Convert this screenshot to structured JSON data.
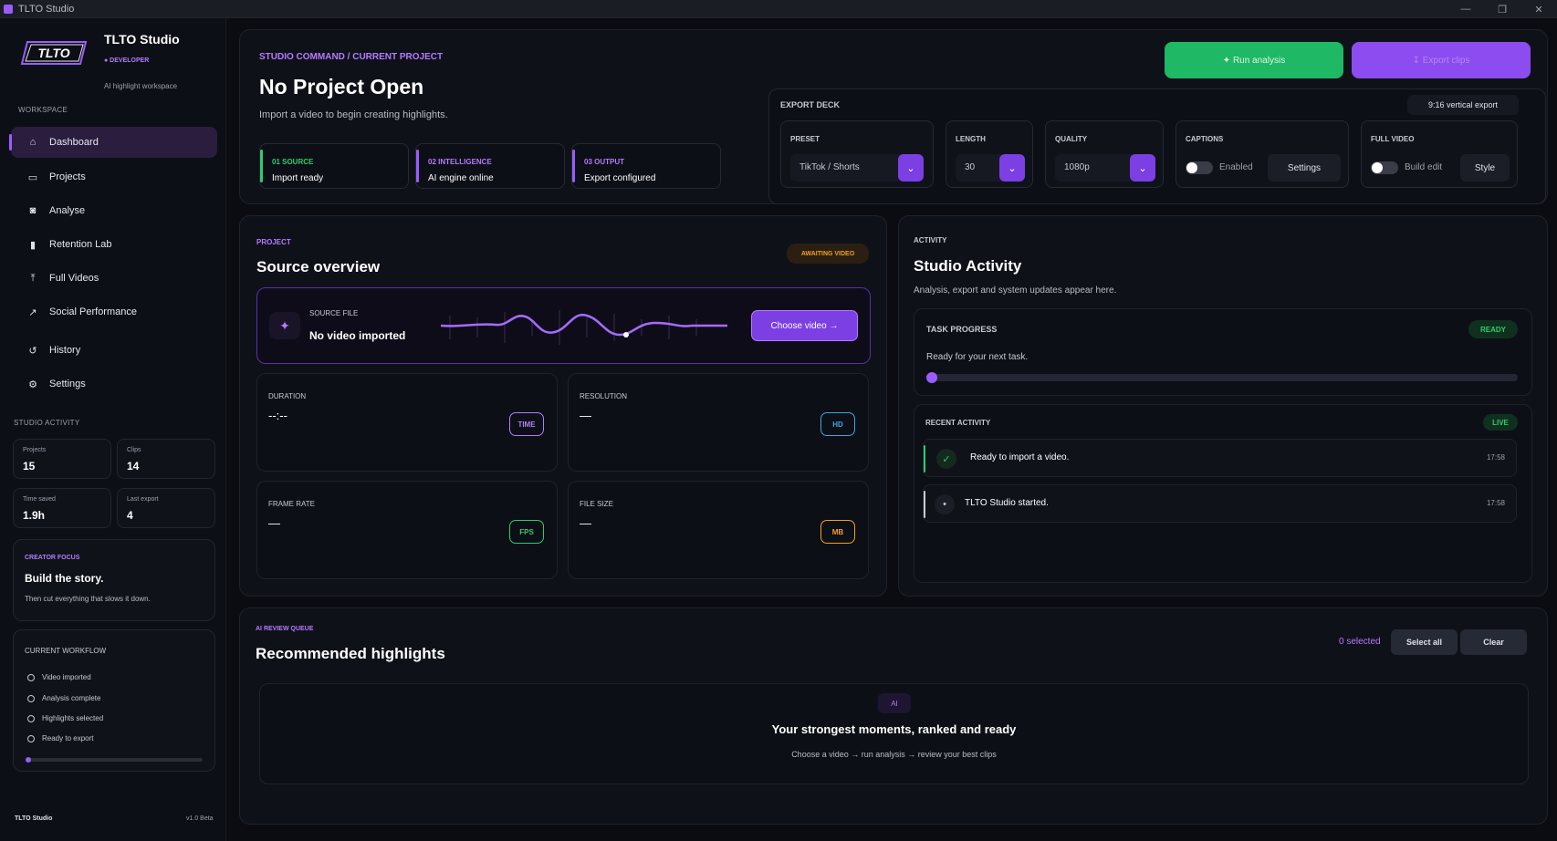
{
  "window": {
    "title": "TLTO Studio",
    "minimize": "—",
    "restore": "❐",
    "close": "✕"
  },
  "brand": {
    "logo_text": "TLTO",
    "name": "TLTO Studio",
    "badge": "● DEVELOPER",
    "tagline": "AI highlight workspace"
  },
  "sidebar": {
    "workspace_label": "WORKSPACE",
    "items": [
      {
        "icon": "⌂",
        "label": "Dashboard",
        "active": true
      },
      {
        "icon": "▭",
        "label": "Projects"
      },
      {
        "icon": "◙",
        "label": "Analyse"
      },
      {
        "icon": "▮",
        "label": "Retention Lab"
      },
      {
        "icon": "⤒",
        "label": "Full Videos"
      },
      {
        "icon": "↗",
        "label": "Social Performance"
      },
      {
        "icon": "↺",
        "label": "History"
      },
      {
        "icon": "⚙",
        "label": "Settings"
      }
    ],
    "activity_label": "STUDIO ACTIVITY",
    "stats": [
      {
        "label": "Projects",
        "value": "15"
      },
      {
        "label": "Clips",
        "value": "14"
      },
      {
        "label": "Time saved",
        "value": "1.9h"
      },
      {
        "label": "Last export",
        "value": "4"
      }
    ],
    "focus": {
      "label": "CREATOR FOCUS",
      "title": "Build the story.",
      "text": "Then cut everything that slows it down."
    },
    "workflow": {
      "label": "CURRENT WORKFLOW",
      "steps": [
        "Video imported",
        "Analysis complete",
        "Highlights selected",
        "Ready to export"
      ],
      "progress": 0.02
    },
    "footer_name": "TLTO Studio",
    "footer_version": "v1.0 Beta"
  },
  "header": {
    "breadcrumb": "STUDIO COMMAND  /  CURRENT PROJECT",
    "title": "No Project Open",
    "subtitle": "Import a video to begin creating highlights.",
    "steps": [
      {
        "num": "01  SOURCE",
        "text": "Import ready",
        "color": "#2ecc71"
      },
      {
        "num": "02  INTELLIGENCE",
        "text": "AI engine online",
        "color": "#9b5cff"
      },
      {
        "num": "03  OUTPUT",
        "text": "Export configured",
        "color": "#9b5cff"
      }
    ],
    "run_label": "✦  Run analysis",
    "export_label": "↧  Export clips"
  },
  "deck": {
    "label": "EXPORT DECK",
    "pill": "9:16 vertical export",
    "preset_label": "PRESET",
    "preset_value": "TikTok / Shorts",
    "length_label": "LENGTH",
    "length_value": "30",
    "quality_label": "QUALITY",
    "quality_value": "1080p",
    "captions_label": "CAPTIONS",
    "captions_toggle": "Enabled",
    "captions_btn": "Settings",
    "full_label": "FULL VIDEO",
    "full_toggle": "Build edit",
    "full_btn": "Style"
  },
  "project": {
    "label": "PROJECT",
    "title": "Source overview",
    "badge": "AWAITING VIDEO",
    "source_label": "SOURCE FILE",
    "source_value": "No video imported",
    "choose": "Choose video  →",
    "metrics": [
      {
        "label": "DURATION",
        "value": "--:--",
        "badge": "TIME",
        "color": "#b47bff"
      },
      {
        "label": "RESOLUTION",
        "value": "—",
        "badge": "HD",
        "color": "#3aa8e8"
      },
      {
        "label": "FRAME RATE",
        "value": "—",
        "badge": "FPS",
        "color": "#2ecc71"
      },
      {
        "label": "FILE SIZE",
        "value": "—",
        "badge": "MB",
        "color": "#f0a020"
      }
    ]
  },
  "activity": {
    "label": "ACTIVITY",
    "title": "Studio Activity",
    "subtitle": "Analysis, export and system updates appear here.",
    "task_label": "TASK PROGRESS",
    "task_badge": "READY",
    "task_text": "Ready for your next task.",
    "task_progress": 0,
    "recent_label": "RECENT ACTIVITY",
    "recent_badge": "LIVE",
    "items": [
      {
        "icon": "✓",
        "text": "Ready to import a video.",
        "time": "17:58"
      },
      {
        "icon": "•",
        "text": "TLTO Studio started.",
        "time": "17:58"
      }
    ]
  },
  "queue": {
    "label": "AI REVIEW QUEUE",
    "title": "Recommended highlights",
    "selected": "0 selected",
    "select_all": "Select all",
    "clear": "Clear",
    "ai_badge": "AI",
    "empty_title": "Your strongest moments, ranked and ready",
    "empty_text": "Choose a video  →  run analysis  →  review your best clips"
  }
}
